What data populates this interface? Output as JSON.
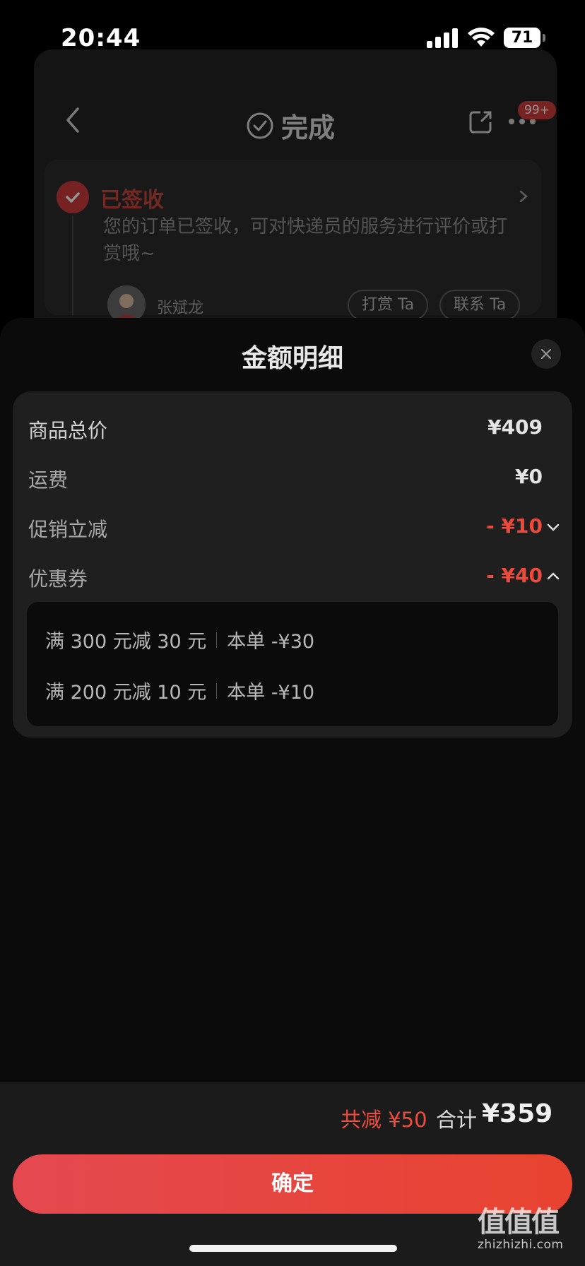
{
  "status_bar": {
    "time": "20:44",
    "battery": "71"
  },
  "background_page": {
    "title": "完成",
    "badge": "99+",
    "order_status": {
      "title": "已签收",
      "description": "您的订单已签收，可对快递员的服务进行评价或打赏哦~",
      "courier_name": "张斌龙",
      "tip_button": "打赏 Ta",
      "contact_button": "联系 Ta"
    }
  },
  "sheet": {
    "title": "金额明细",
    "rows": [
      {
        "label": "商品总价",
        "value": "¥409"
      },
      {
        "label": "运费",
        "value": "¥0"
      },
      {
        "label": "促销立减",
        "value": "- ¥10"
      },
      {
        "label": "优惠券",
        "value": "- ¥40"
      }
    ],
    "coupons": [
      {
        "rule": "满 300 元减 30 元",
        "applied": "本单 -¥30"
      },
      {
        "rule": "满 200 元减 10 元",
        "applied": "本单 -¥10"
      }
    ]
  },
  "footer": {
    "savings": "共减 ¥50",
    "total_label": "合计",
    "total_value": "¥359",
    "confirm": "确定"
  },
  "watermark": {
    "glyphs": "值值值",
    "url": "zhizhizhi.com"
  },
  "colors": {
    "accent_red": "#ee4a3b",
    "button_start": "#e5484f",
    "button_end": "#e84330"
  },
  "icons": [
    "back-icon",
    "check-circle-icon",
    "share-icon",
    "more-icon",
    "check-icon",
    "chevron-right-icon",
    "close-icon",
    "chevron-down-icon",
    "chevron-up-icon"
  ]
}
